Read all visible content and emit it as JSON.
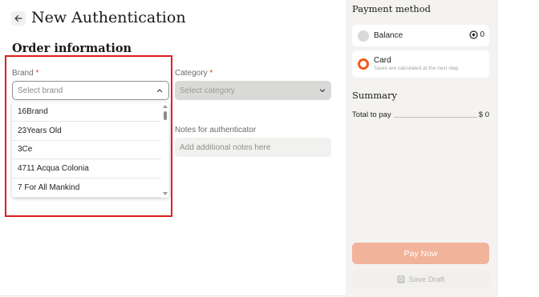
{
  "header": {
    "back_icon": "arrow-left-icon",
    "title": "New Authentication"
  },
  "order": {
    "section_title": "Order information",
    "brand": {
      "label": "Brand",
      "required_mark": "*",
      "placeholder": "Select brand",
      "state": "open",
      "options": [
        "16Brand",
        "23Years Old",
        "3Ce",
        "4711 Acqua Colonia",
        "7 For All Mankind"
      ]
    },
    "category": {
      "label": "Category",
      "required_mark": "*",
      "placeholder": "Select category",
      "state": "disabled"
    },
    "notes": {
      "label": "Notes for authenticator",
      "placeholder": "Add additional notes here",
      "value": ""
    }
  },
  "payment": {
    "heading": "Payment method",
    "balance": {
      "label": "Balance",
      "value": "0",
      "selected": false
    },
    "card": {
      "label": "Card",
      "sublabel": "Taxes are calculated at the next step",
      "selected": true
    }
  },
  "summary": {
    "heading": "Summary",
    "total_label": "Total to pay",
    "total_value": "$ 0"
  },
  "actions": {
    "pay_now": "Pay Now",
    "save_draft": "Save Draft"
  },
  "colors": {
    "accent": "#f25a1d",
    "pay_button": "#f2b39b",
    "highlight": "#e01e1e",
    "panel_bg": "#f4f3f1"
  }
}
